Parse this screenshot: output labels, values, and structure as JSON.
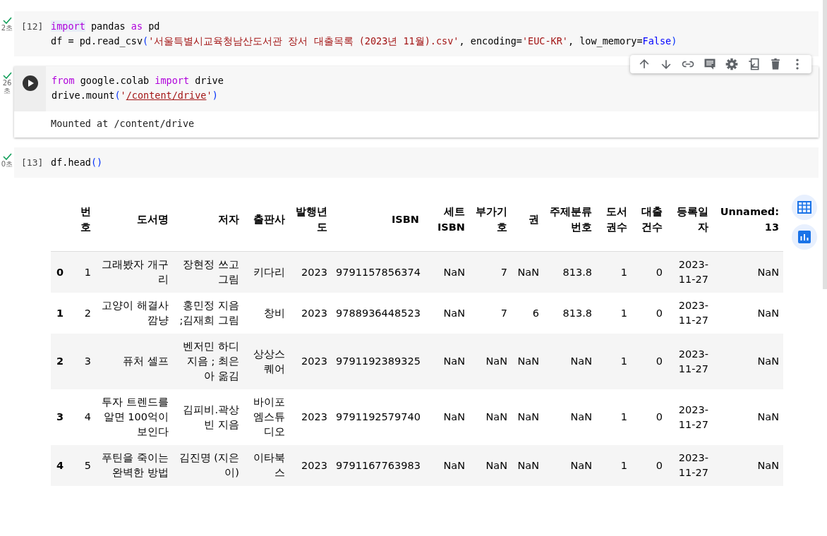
{
  "cells": [
    {
      "kind": "code",
      "succeeded": true,
      "time": "2초",
      "prompt": "[12]",
      "focused": false,
      "code": [
        [
          {
            "t": "import",
            "kind": "keyword",
            "highlighted": true
          },
          {
            "t": " pandas ",
            "kind": "plain"
          },
          {
            "t": "as",
            "kind": "keyword"
          },
          {
            "t": " pd",
            "kind": "plain"
          }
        ],
        [
          {
            "t": "df = pd.read_csv",
            "kind": "plain"
          },
          {
            "t": "(",
            "kind": "paren"
          },
          {
            "t": "'서울특별시교육청남산도서관 장서 대출목록 (2023년 11월).csv'",
            "kind": "string"
          },
          {
            "t": ", encoding=",
            "kind": "plain"
          },
          {
            "t": "'EUC-KR'",
            "kind": "string"
          },
          {
            "t": ", low_memory=",
            "kind": "plain"
          },
          {
            "t": "False",
            "kind": "constant"
          },
          {
            "t": ")",
            "kind": "paren"
          }
        ]
      ]
    },
    {
      "kind": "code",
      "succeeded": true,
      "time": "26초",
      "focused": true,
      "code": [
        [
          {
            "t": "from",
            "kind": "keyword"
          },
          {
            "t": " google.colab ",
            "kind": "plain"
          },
          {
            "t": "import",
            "kind": "keyword"
          },
          {
            "t": " drive",
            "kind": "plain"
          }
        ],
        [
          {
            "t": "drive.mount",
            "kind": "plain"
          },
          {
            "t": "(",
            "kind": "paren"
          },
          {
            "t": "'",
            "kind": "string"
          },
          {
            "t": "/content/drive",
            "kind": "path"
          },
          {
            "t": "'",
            "kind": "string"
          },
          {
            "t": ")",
            "kind": "paren"
          }
        ]
      ],
      "output": "Mounted at /content/drive"
    },
    {
      "kind": "code",
      "succeeded": true,
      "time": "0초",
      "prompt": "[13]",
      "focused": false,
      "code": [
        [
          {
            "t": "df.head",
            "kind": "plain"
          },
          {
            "t": "()",
            "kind": "paren"
          }
        ]
      ]
    }
  ],
  "dataframe": {
    "columns": [
      "번호",
      "도서명",
      "저자",
      "출판사",
      "발행년도",
      "ISBN",
      "세트ISBN",
      "부가기호",
      "권",
      "주제분류번호",
      "도서권수",
      "대출건수",
      "등록일자",
      "Unnamed: 13"
    ],
    "rows": [
      {
        "index": "0",
        "values": [
          "1",
          "그래봤자 개구리",
          "장현정 쓰고 그림",
          "키다리",
          "2023",
          "9791157856374",
          "NaN",
          "7",
          "NaN",
          "813.8",
          "1",
          "0",
          "2023-11-27",
          "NaN"
        ]
      },
      {
        "index": "1",
        "values": [
          "2",
          "고양이 해결사 깜냥",
          "홍민정 지음 ;김재희 그림",
          "창비",
          "2023",
          "9788936448523",
          "NaN",
          "7",
          "6",
          "813.8",
          "1",
          "0",
          "2023-11-27",
          "NaN"
        ]
      },
      {
        "index": "2",
        "values": [
          "3",
          "퓨처 셀프",
          "벤저민 하디 지음 ; 최은아 옮김",
          "상상스퀘어",
          "2023",
          "9791192389325",
          "NaN",
          "NaN",
          "NaN",
          "NaN",
          "1",
          "0",
          "2023-11-27",
          "NaN"
        ]
      },
      {
        "index": "3",
        "values": [
          "4",
          "투자 트렌드를 알면 100억이 보인다",
          "김피비.곽상빈 지음",
          "바이포엠스튜디오",
          "2023",
          "9791192579740",
          "NaN",
          "NaN",
          "NaN",
          "NaN",
          "1",
          "0",
          "2023-11-27",
          "NaN"
        ]
      },
      {
        "index": "4",
        "values": [
          "5",
          "푸틴을 죽이는 완벽한 방법",
          "김진명 (지은이)",
          "이타북스",
          "2023",
          "9791167763983",
          "NaN",
          "NaN",
          "NaN",
          "NaN",
          "1",
          "0",
          "2023-11-27",
          "NaN"
        ]
      }
    ]
  }
}
